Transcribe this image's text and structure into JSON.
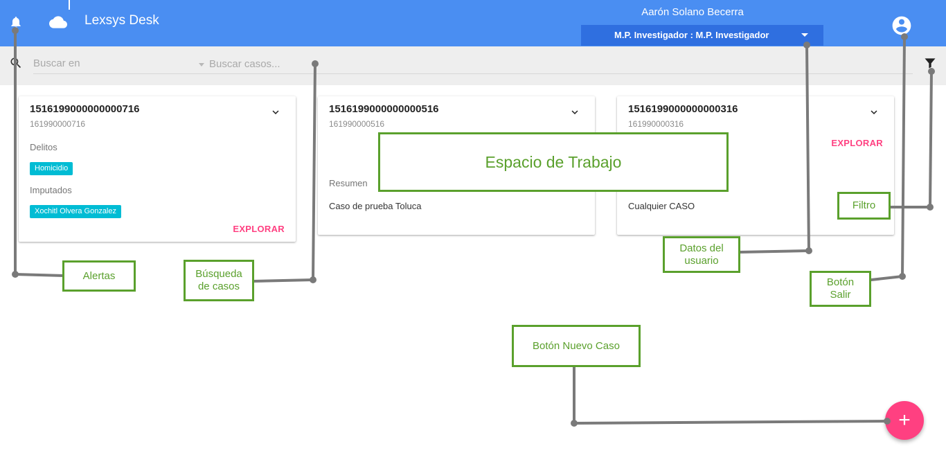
{
  "header": {
    "app_title": "Lexsys Desk",
    "user_name": "Aarón Solano Becerra",
    "role_selected": "M.P. Investigador : M.P. Investigador",
    "icons": [
      "bell-icon",
      "cloud-icon",
      "account-icon"
    ]
  },
  "search": {
    "scope_placeholder": "Buscar en",
    "query_placeholder": "Buscar casos...",
    "icons": [
      "search-icon",
      "filter-icon"
    ]
  },
  "cards": [
    {
      "title": "1516199000000000716",
      "subtitle": "161990000716",
      "delitos_label": "Delitos",
      "delito": "Homicidio",
      "imputados_label": "Imputados",
      "imputado": "Xochitl Olvera Gonzalez",
      "explore": "EXPLORAR"
    },
    {
      "title": "1516199000000000516",
      "subtitle": "161990000516",
      "resumen_label": "Resumen",
      "resumen": "Caso de prueba Toluca"
    },
    {
      "title": "1516199000000000316",
      "subtitle": "161990000316",
      "explore": "EXPLORAR",
      "resumen": "Cualquier CASO"
    }
  ],
  "fab": {
    "label": "+"
  },
  "annotations": {
    "workspace": "Espacio de Trabajo",
    "alerts": "Alertas",
    "search": "Búsqueda de casos",
    "user_data": "Datos del usuario",
    "filter": "Filtro",
    "exit_button": "Botón Salir",
    "new_case_button": "Botón Nuevo Caso"
  },
  "colors": {
    "appbar": "#4a8ef2",
    "role_bar": "#2f6fe0",
    "accent": "#ff4081",
    "chip": "#00bcd4",
    "annotation": "#5aa02c",
    "connector": "#7a7a7a"
  }
}
